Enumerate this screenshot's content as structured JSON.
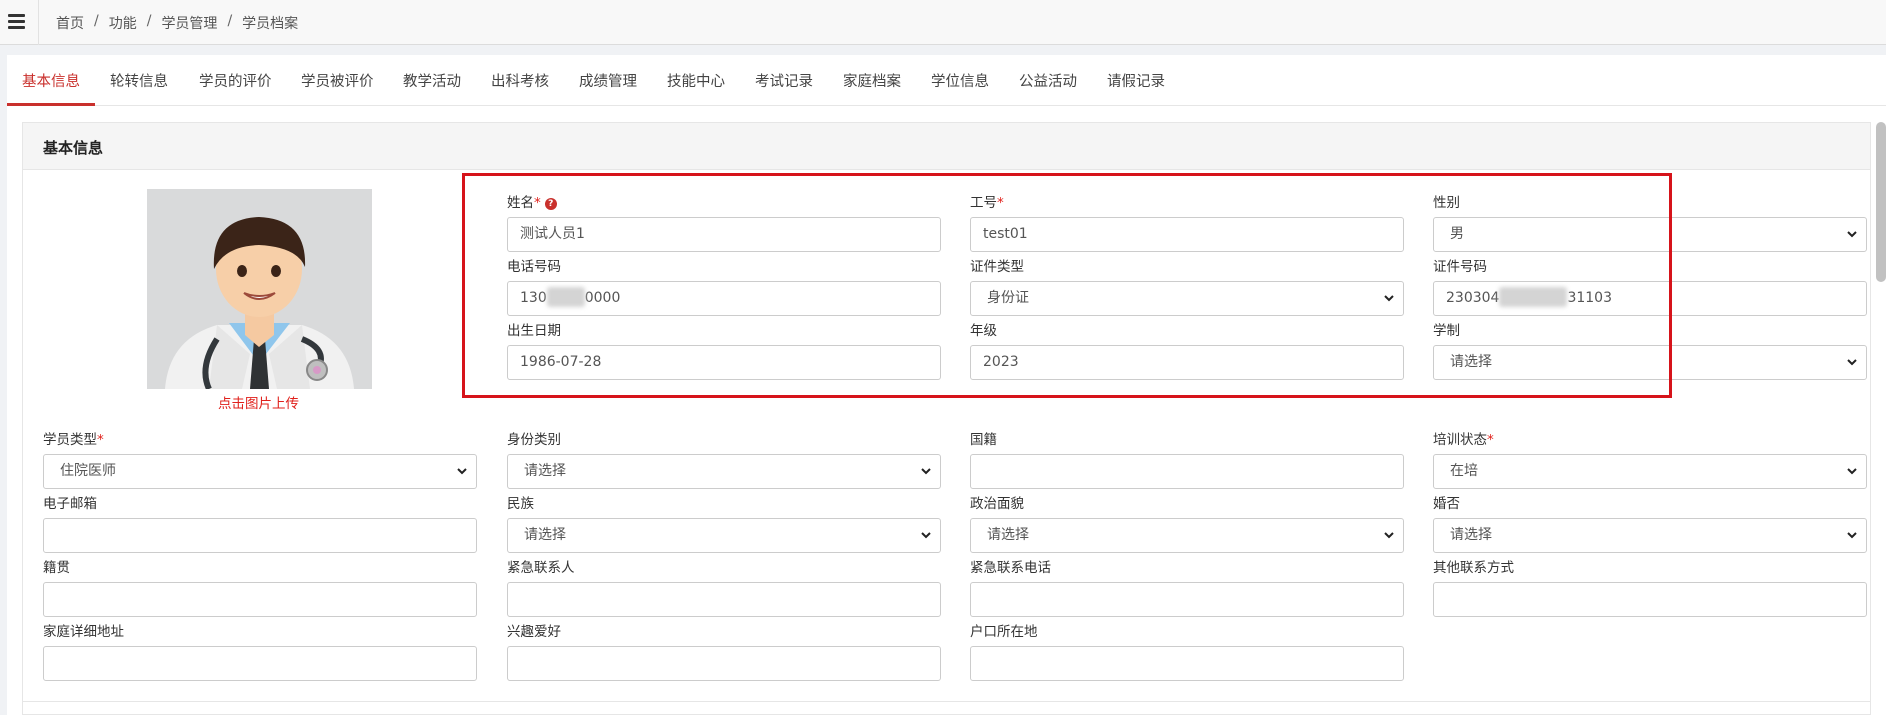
{
  "breadcrumb": [
    "首页",
    "功能",
    "学员管理",
    "学员档案"
  ],
  "tabs": [
    "基本信息",
    "轮转信息",
    "学员的评价",
    "学员被评价",
    "教学活动",
    "出科考核",
    "成绩管理",
    "技能中心",
    "考试记录",
    "家庭档案",
    "学位信息",
    "公益活动",
    "请假记录"
  ],
  "panel_title": "基本信息",
  "avatar": {
    "upload_label": "点击图片上传"
  },
  "fields": {
    "name": {
      "label": "姓名",
      "value": "测试人员1"
    },
    "staff_no": {
      "label": "工号",
      "value": "test01"
    },
    "gender": {
      "label": "性别",
      "value": "男"
    },
    "phone": {
      "label": "电话号码",
      "value_start": "130",
      "value_end": "0000"
    },
    "id_type": {
      "label": "证件类型",
      "value": "身份证"
    },
    "id_no": {
      "label": "证件号码",
      "value_start": "230304",
      "value_end": "31103"
    },
    "birth": {
      "label": "出生日期",
      "value": "1986-07-28"
    },
    "grade": {
      "label": "年级",
      "value": "2023"
    },
    "schooling": {
      "label": "学制",
      "value": "请选择"
    },
    "student_type": {
      "label": "学员类型",
      "value": "住院医师"
    },
    "identity_type": {
      "label": "身份类别",
      "value": "请选择"
    },
    "nationality": {
      "label": "国籍",
      "value": ""
    },
    "training_status": {
      "label": "培训状态",
      "value": "在培"
    },
    "email": {
      "label": "电子邮箱",
      "value": ""
    },
    "ethnicity": {
      "label": "民族",
      "value": "请选择"
    },
    "political": {
      "label": "政治面貌",
      "value": "请选择"
    },
    "marital": {
      "label": "婚否",
      "value": "请选择"
    },
    "native_place": {
      "label": "籍贯",
      "value": ""
    },
    "emergency_contact": {
      "label": "紧急联系人",
      "value": ""
    },
    "emergency_phone": {
      "label": "紧急联系电话",
      "value": ""
    },
    "other_contact": {
      "label": "其他联系方式",
      "value": ""
    },
    "home_address": {
      "label": "家庭详细地址",
      "value": ""
    },
    "hobbies": {
      "label": "兴趣爱好",
      "value": ""
    },
    "hukou": {
      "label": "户口所在地",
      "value": ""
    }
  },
  "required_marker": "*",
  "help_glyph": "?",
  "colors": {
    "accent": "#c9302c",
    "required": "#e0201b",
    "highlight": "#d6131a"
  },
  "icons": {
    "menu": "hamburger-icon",
    "help": "question-circle-icon",
    "select": "chevron-down-icon"
  }
}
